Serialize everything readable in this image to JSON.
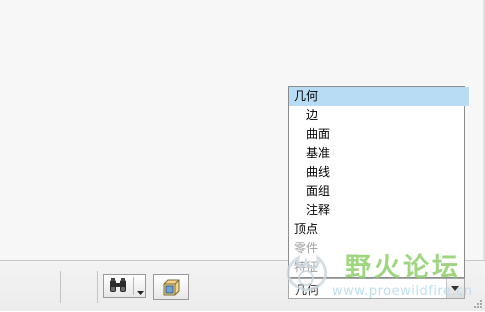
{
  "statusbar": {
    "find_button": {
      "icon": "binoculars-icon"
    },
    "view_button": {
      "icon": "cube-view-icon"
    }
  },
  "filter": {
    "selected_value": "几何",
    "options": [
      {
        "label": "几何",
        "level": 0,
        "state": "selected"
      },
      {
        "label": "边",
        "level": 1,
        "state": "normal"
      },
      {
        "label": "曲面",
        "level": 1,
        "state": "normal"
      },
      {
        "label": "基准",
        "level": 1,
        "state": "normal"
      },
      {
        "label": "曲线",
        "level": 1,
        "state": "normal"
      },
      {
        "label": "面组",
        "level": 1,
        "state": "normal"
      },
      {
        "label": "注释",
        "level": 1,
        "state": "normal"
      },
      {
        "label": "顶点",
        "level": 0,
        "state": "normal"
      },
      {
        "label": "零件",
        "level": 0,
        "state": "disabled"
      },
      {
        "label": "特征",
        "level": 0,
        "state": "disabled"
      }
    ]
  },
  "watermark": {
    "title": "野火论坛",
    "url": "www.proewildfire.cn"
  },
  "colors": {
    "selection": "#b9dcf5",
    "watermark_green": "#8ed06b",
    "watermark_blue": "#b9dcef"
  }
}
